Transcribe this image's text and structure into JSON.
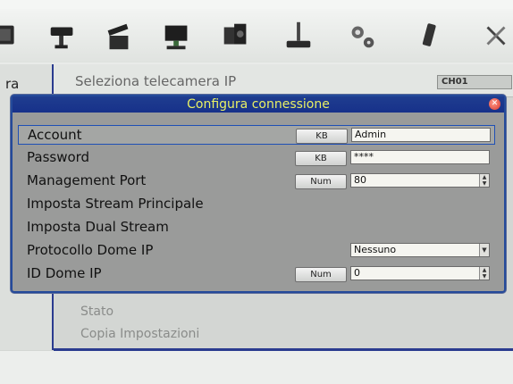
{
  "toolbar": {
    "icons": [
      "monitor-icon",
      "camera-icon",
      "clapperboard-icon",
      "network-monitor-icon",
      "device-bundle-icon",
      "joystick-icon",
      "gears-icon",
      "usb-icon",
      "tools-icon"
    ]
  },
  "background": {
    "left_label": "ra",
    "header_label": "Seleziona telecamera IP",
    "channel": "CH01",
    "items": [
      "Stato",
      "Copia Impostazioni"
    ]
  },
  "dialog": {
    "title": "Configura connessione",
    "close_icon": "close-icon",
    "rows": [
      {
        "label": "Account",
        "button": "KB",
        "value": "Admin"
      },
      {
        "label": "Password",
        "button": "KB",
        "value": "****"
      },
      {
        "label": "Management Port",
        "button": "Num",
        "value": "80"
      },
      {
        "label": "Imposta Stream Principale"
      },
      {
        "label": "Imposta Dual Stream"
      },
      {
        "label": "Protocollo Dome IP",
        "value": "Nessuno"
      },
      {
        "label": "ID Dome IP",
        "button": "Num",
        "value": "0"
      }
    ]
  },
  "colors": {
    "title_bar": "#1f3d8f",
    "title_text": "#e9f064",
    "dialog_bg": "#9a9b9a",
    "accent_border": "#244a9a"
  }
}
